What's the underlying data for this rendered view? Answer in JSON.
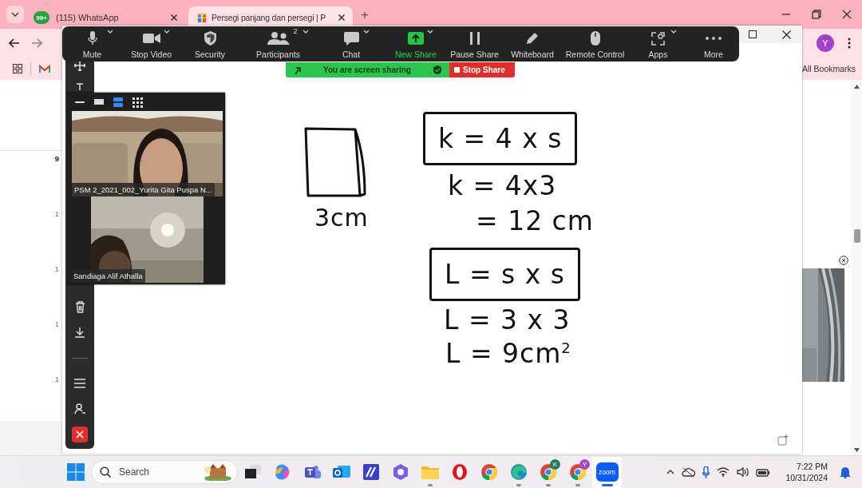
{
  "browser": {
    "tabs": [
      {
        "title": "(115) WhatsApp",
        "badge": "99+",
        "selected": false
      },
      {
        "title": "Persegi panjang dan persegi | P",
        "selected": true
      }
    ],
    "new_tab": "+",
    "profile_initial": "Y",
    "bookmarks_label": "All Bookmarks"
  },
  "page": {
    "ruler_labels": [
      "9",
      "1",
      "1",
      "1",
      "1"
    ]
  },
  "meeting_toolbar": {
    "items": [
      {
        "label": "Mute",
        "caret": true,
        "active": false
      },
      {
        "label": "Stop Video",
        "caret": true,
        "active": false
      },
      {
        "label": "Security",
        "caret": false,
        "active": false
      },
      {
        "label": "Participants",
        "caret": true,
        "active": false,
        "count": "2"
      },
      {
        "label": "Chat",
        "caret": true,
        "active": false
      },
      {
        "label": "New Share",
        "caret": true,
        "active": true
      },
      {
        "label": "Pause Share",
        "caret": false,
        "active": false
      },
      {
        "label": "Whiteboard",
        "caret": false,
        "active": false
      },
      {
        "label": "Remote Control",
        "caret": false,
        "active": false
      },
      {
        "label": "Apps",
        "caret": true,
        "active": false
      },
      {
        "label": "More",
        "caret": false,
        "active": false
      }
    ]
  },
  "share_bar": {
    "status": "You are screen sharing",
    "stop": "Stop Share"
  },
  "videos": {
    "layouts": [
      {
        "selected": false
      },
      {
        "selected": false
      },
      {
        "selected": true
      },
      {
        "selected": false
      }
    ],
    "tiles": [
      {
        "name": "PSM 2_2021_002_Yurita Gita Puspa N..."
      },
      {
        "name": "Sandiaga Alif Athalla"
      }
    ]
  },
  "whiteboard": {
    "side_label": "3cm",
    "notes": [
      {
        "text": "k = 4 x s",
        "boxed": true
      },
      {
        "text": "k = 4x3",
        "boxed": false
      },
      {
        "text": "= 12 cm",
        "boxed": false
      },
      {
        "text": "L = s x s",
        "boxed": true
      },
      {
        "text": "L = 3 x 3",
        "boxed": false
      },
      {
        "text": "L = 9cm$^{2}$",
        "boxed": false
      }
    ]
  },
  "taskbar": {
    "search_placeholder": "Search",
    "apps": [
      {
        "running": false,
        "selected": false
      },
      {
        "running": false,
        "selected": false
      },
      {
        "running": false,
        "selected": false
      },
      {
        "running": false,
        "selected": false
      },
      {
        "running": false,
        "selected": false
      },
      {
        "running": false,
        "selected": false
      },
      {
        "running": true,
        "selected": false
      },
      {
        "running": false,
        "selected": false
      },
      {
        "running": false,
        "selected": false
      },
      {
        "running": true,
        "selected": false
      },
      {
        "running": true,
        "selected": false,
        "badge": "K",
        "color": "#1e7b67"
      },
      {
        "running": true,
        "selected": false,
        "badge": "Y",
        "color": "#a24ac4"
      },
      {
        "running": true,
        "selected": true,
        "label": "zoom"
      }
    ],
    "time": "7:22 PM",
    "date": "10/31/2024"
  }
}
